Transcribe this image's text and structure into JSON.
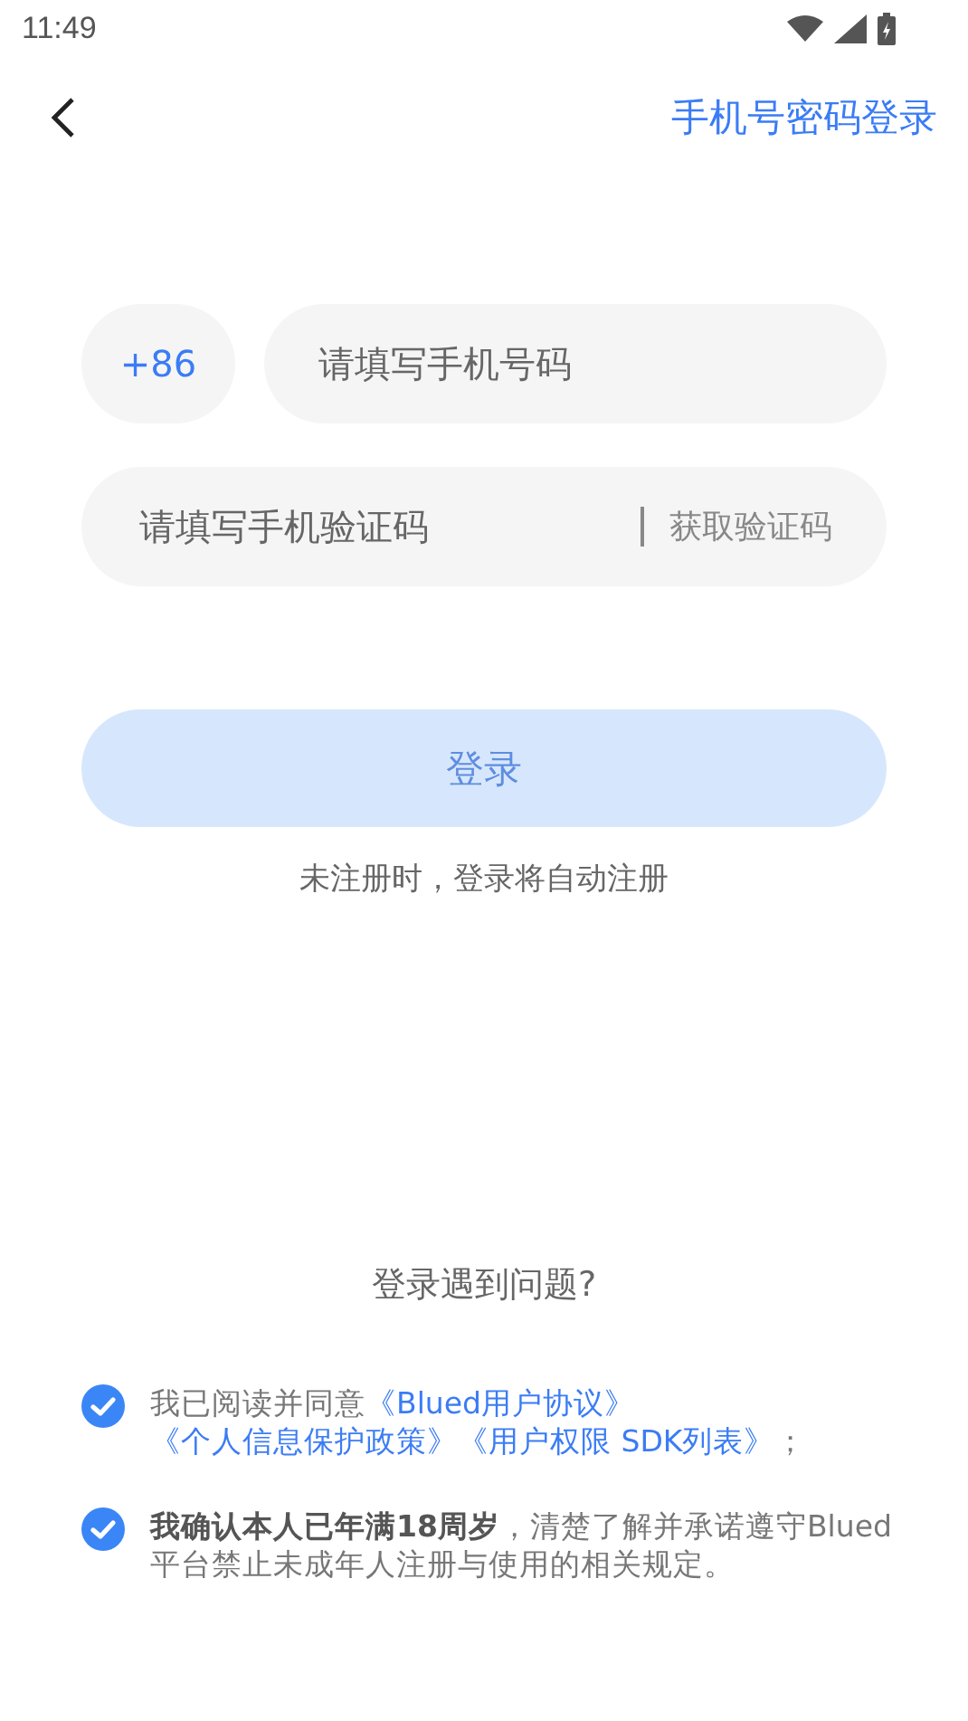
{
  "status_bar": {
    "time": "11:49"
  },
  "header": {
    "mode_link": "手机号密码登录"
  },
  "phone": {
    "country_code": "+86",
    "placeholder": "请填写手机号码"
  },
  "code": {
    "placeholder": "请填写手机验证码",
    "get_code": "获取验证码"
  },
  "login_button": {
    "label": "登录",
    "disabled": true
  },
  "hint": "未注册时，登录将自动注册",
  "help_link": "登录遇到问题?",
  "agreements": [
    {
      "checked": true,
      "parts": [
        {
          "kind": "text",
          "text": "我已阅读并同意"
        },
        {
          "kind": "link",
          "text": "《Blued用户协议》"
        },
        {
          "kind": "link",
          "text": "《个人信息保护政策》"
        },
        {
          "kind": "link",
          "text": "《用户权限 SDK列表》"
        },
        {
          "kind": "text",
          "text": "；"
        }
      ]
    },
    {
      "checked": true,
      "parts": [
        {
          "kind": "text",
          "text": "**我确认本人已年满18周岁**，清楚了解并承诺遵守Blued平台禁止未成年人注册与使用的相关规定。"
        }
      ]
    }
  ]
}
